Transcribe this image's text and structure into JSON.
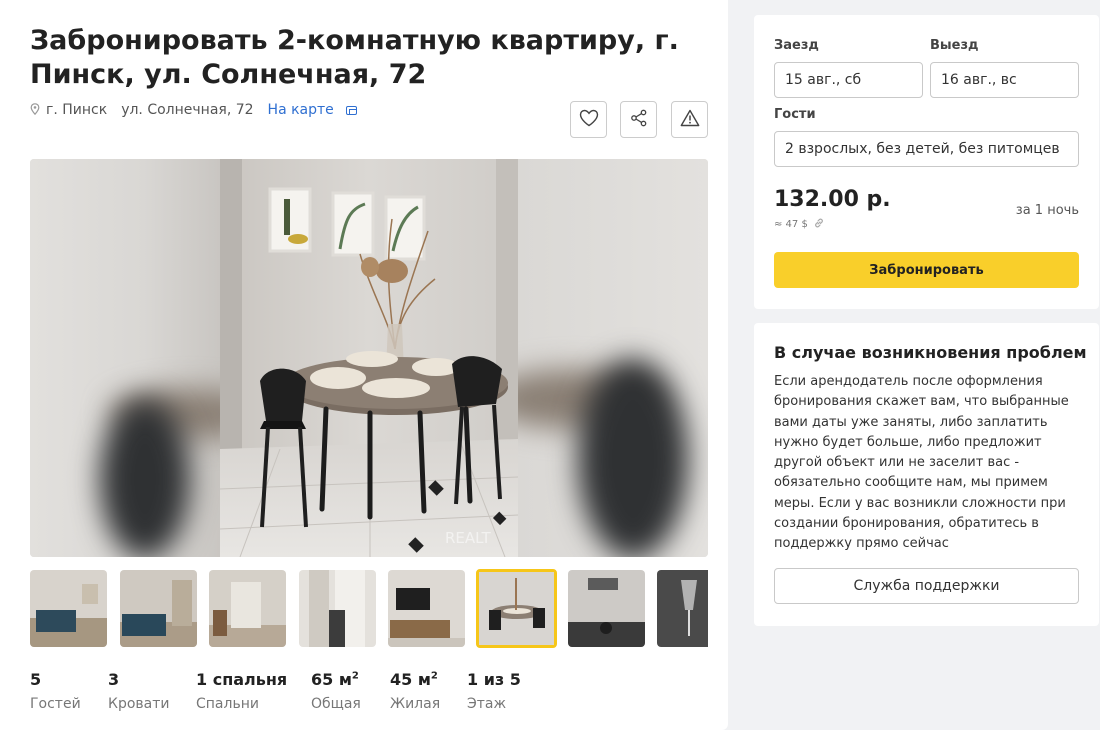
{
  "listing": {
    "title": "Забронировать 2-комнатную квартиру, г. Пинск, ул. Солнечная, 72",
    "city": "г. Пинск",
    "street": "ул. Солнечная, 72",
    "map_link": "На карте"
  },
  "icons": {
    "favorite": "heart-icon",
    "share": "share-icon",
    "report": "warning-icon",
    "location": "pin-icon",
    "map": "map-window-icon"
  },
  "gallery": {
    "watermark": "REALT",
    "thumbnail_count": 8,
    "selected_index": 5
  },
  "stats": [
    {
      "value": "5",
      "label": "Гостей"
    },
    {
      "value": "3",
      "label": "Кровати"
    },
    {
      "value": "1 спальня",
      "label": "Спальни"
    },
    {
      "value": "65 м",
      "sup": "2",
      "label": "Общая"
    },
    {
      "value": "45 м",
      "sup": "2",
      "label": "Жилая"
    },
    {
      "value": "1 из 5",
      "label": "Этаж"
    }
  ],
  "booking": {
    "checkin_label": "Заезд",
    "checkin_value": "15 авг., сб",
    "checkout_label": "Выезд",
    "checkout_value": "16 авг., вс",
    "guests_label": "Гости",
    "guests_value": "2 взрослых, без детей, без питомцев",
    "price": "132.00 р.",
    "price_usd": "≈ 47 $",
    "per_night": "за 1 ночь",
    "book_button": "Забронировать"
  },
  "help": {
    "title": "В случае возникновения проблем",
    "text": "Если арендодатель после оформления бронирования скажет вам, что выбранные вами даты уже заняты, либо заплатить нужно будет больше, либо предложит другой объект или не заселит вас - обязательно сообщите нам, мы примем меры. Если у вас возникли сложности при создании бронирования, обратитесь в поддержку прямо сейчас",
    "support_button": "Служба поддержки"
  },
  "colors": {
    "accent_yellow": "#f9cf2a",
    "link_blue": "#2f6fd1",
    "page_bg": "#f1f2f4"
  }
}
